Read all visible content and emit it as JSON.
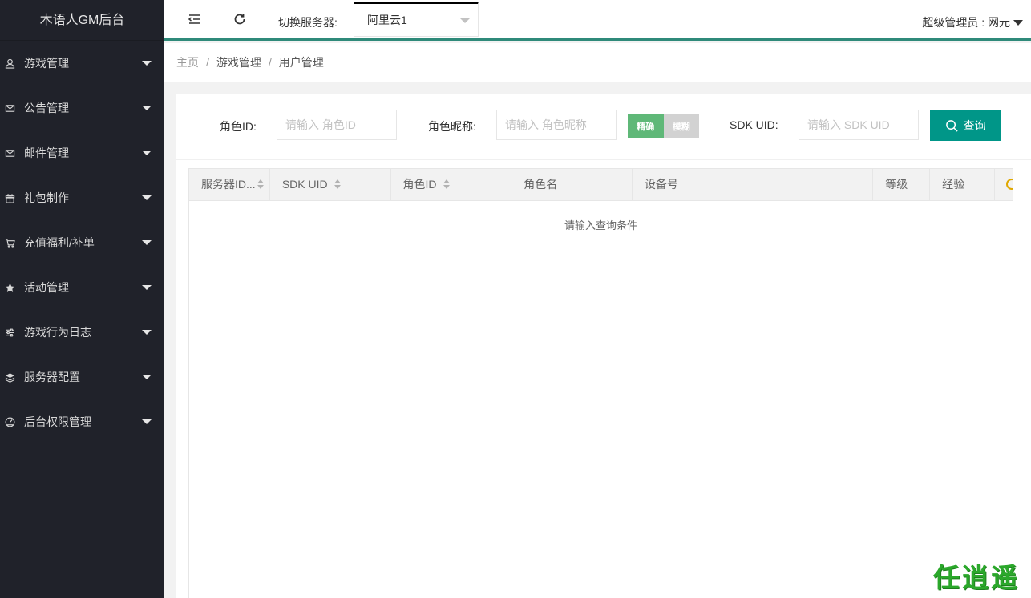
{
  "app": {
    "title": "木语人GM后台"
  },
  "sidebar": {
    "items": [
      {
        "label": "游戏管理",
        "icon": "user-icon"
      },
      {
        "label": "公告管理",
        "icon": "mail-icon"
      },
      {
        "label": "邮件管理",
        "icon": "mail-icon"
      },
      {
        "label": "礼包制作",
        "icon": "gift-icon"
      },
      {
        "label": "充值福利/补单",
        "icon": "cart-icon"
      },
      {
        "label": "活动管理",
        "icon": "star-icon"
      },
      {
        "label": "游戏行为日志",
        "icon": "sliders-icon"
      },
      {
        "label": "服务器配置",
        "icon": "layers-icon"
      },
      {
        "label": "后台权限管理",
        "icon": "gauge-icon"
      }
    ]
  },
  "header": {
    "server_label": "切换服务器:",
    "server_value": "阿里云1",
    "admin": "超级管理员 : 网元"
  },
  "breadcrumb": [
    "主页",
    "游戏管理",
    "用户管理"
  ],
  "form": {
    "role_id_label": "角色ID:",
    "role_id_placeholder": "请输入 角色ID",
    "nickname_label": "角色昵称:",
    "nickname_placeholder": "请输入 角色昵称",
    "mode_exact": "精确",
    "mode_fuzzy": "模糊",
    "sdk_uid_label": "SDK UID:",
    "sdk_uid_placeholder": "请输入 SDK UID",
    "query_button": "查询"
  },
  "table": {
    "columns": [
      {
        "label": "服务器ID...",
        "sortable": true
      },
      {
        "label": "SDK UID",
        "sortable": true
      },
      {
        "label": "角色ID",
        "sortable": true
      },
      {
        "label": "角色名",
        "sortable": false
      },
      {
        "label": "设备号",
        "sortable": false
      },
      {
        "label": "等级",
        "sortable": false
      },
      {
        "label": "经验",
        "sortable": false
      }
    ],
    "empty_text": "请输入查询条件"
  },
  "watermark": "任逍遥",
  "colors": {
    "sidebar_bg": "#20222a",
    "accent": "#009688",
    "header_border": "#2f8a7a",
    "toggle_on": "#5fb878"
  }
}
